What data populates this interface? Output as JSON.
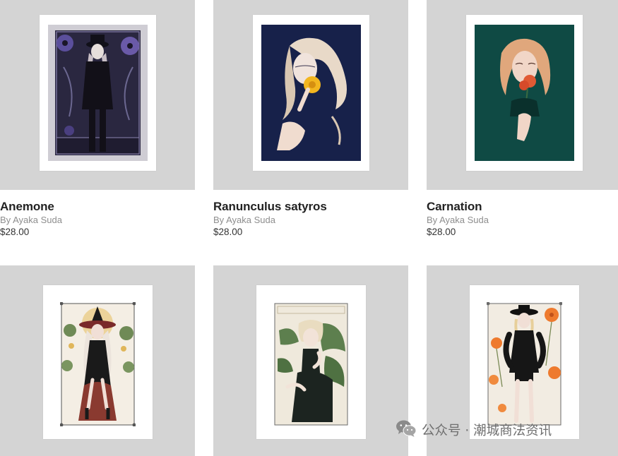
{
  "products": [
    {
      "title": "Anemone",
      "artist": "By Ayaka Suda",
      "price": "$28.00",
      "artwork_icon": "anemone-artwork-icon"
    },
    {
      "title": "Ranunculus satyros",
      "artist": "By Ayaka Suda",
      "price": "$28.00",
      "artwork_icon": "ranunculus-artwork-icon"
    },
    {
      "title": "Carnation",
      "artist": "By Ayaka Suda",
      "price": "$28.00",
      "artwork_icon": "carnation-artwork-icon"
    },
    {
      "artwork_icon": "witch-artwork-icon"
    },
    {
      "artwork_icon": "monstera-artwork-icon"
    },
    {
      "artwork_icon": "cosmos-artwork-icon"
    }
  ],
  "watermark": {
    "text": "公众号 · 潮城商法资讯",
    "icon": "wechat-icon"
  },
  "colors": {
    "tile_bg": "#d4d4d4",
    "anemone_bg": "#2a2740",
    "ranunculus_bg": "#17214a",
    "carnation_bg": "#0f4a44",
    "title_text": "#222222",
    "artist_text": "#8e8e8e"
  }
}
